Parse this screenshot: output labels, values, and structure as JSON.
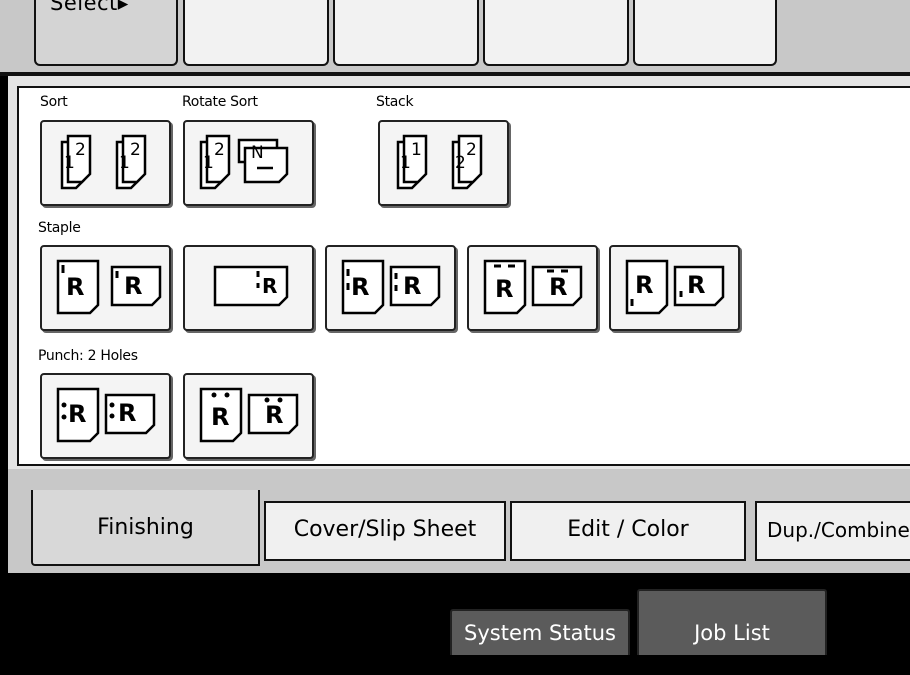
{
  "top": {
    "select_label": "Select▸"
  },
  "groups": {
    "sort": "Sort",
    "rotate_sort": "Rotate Sort",
    "stack": "Stack",
    "staple": "Staple",
    "punch": "Punch: 2 Holes"
  },
  "icons": {
    "sort": [
      "sort-pages-icon"
    ],
    "rotate_sort": [
      "rotate-sort-pages-icon"
    ],
    "stack": [
      "stack-pages-icon"
    ],
    "staple": [
      "staple-top-left-icon",
      "staple-top-left-landscape-icon",
      "staple-left-2-icon",
      "staple-top-2-icon",
      "staple-bottom-left-icon"
    ],
    "punch": [
      "punch-left-icon",
      "punch-top-icon"
    ]
  },
  "tabs": {
    "finishing": "Finishing",
    "cover": "Cover/Slip Sheet",
    "edit": "Edit / Color",
    "dup": "Dup./Combine"
  },
  "status": {
    "system_status": "System Status",
    "job_list": "Job List"
  }
}
